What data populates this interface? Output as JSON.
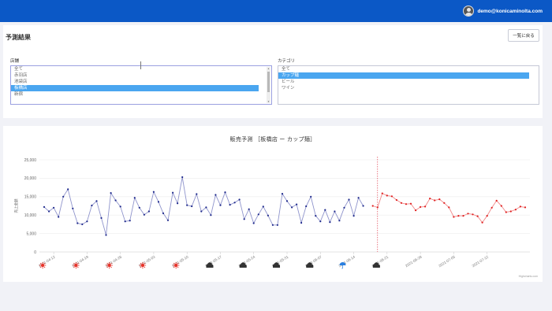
{
  "header": {
    "user_email": "demo@konicaminolta.com"
  },
  "page": {
    "title": "予測結果",
    "back_button": "一覧に戻る"
  },
  "store_select": {
    "label": "店舗",
    "options": [
      "全て",
      "赤羽店",
      "池袋店",
      "板橋店",
      "新宿"
    ],
    "selected": "板橋店"
  },
  "category_select": {
    "label": "カテゴリ",
    "options": [
      "全て",
      "カップ麺",
      "ビール",
      "ワイン"
    ],
    "selected": "カップ麺"
  },
  "chart": {
    "credit": "Highcharts.com"
  },
  "chart_data": {
    "type": "line",
    "title": "販売予測 ［板橋店 ー カップ麺］",
    "ylabel": "売上金額",
    "ylim": [
      0,
      25000
    ],
    "yticks": [
      "0",
      "5,000",
      "10,000",
      "15,000",
      "20,000",
      "25,000"
    ],
    "xticks": [
      "2021-04-12",
      "2021-04-19",
      "2021-04-26",
      "2021-05-03",
      "2021-05-10",
      "2021-05-17",
      "2021-05-24",
      "2021-05-31",
      "2021-06-07",
      "2021-06-14",
      "2021-06-21",
      "2021-06-28",
      "2021-07-05",
      "2021-07-12"
    ],
    "forecast_start": "2021-06-19",
    "weather": [
      "sunny",
      "sunny",
      "sunny",
      "sunny",
      "sunny",
      "cloudy",
      "cloudy",
      "cloudy",
      "cloudy",
      "rainy",
      "cloudy"
    ],
    "colors": {
      "actual": "#1f2a8c",
      "actual_line": "#8f94cc",
      "forecast": "#e02020",
      "forecast_line": "#f08a8a",
      "divider": "#e04050"
    },
    "series": [
      {
        "kind": "actual",
        "start": "2021-04-10",
        "values": [
          12200,
          11000,
          12000,
          9500,
          15000,
          17000,
          11800,
          7800,
          7500,
          8300,
          12600,
          13800,
          9200,
          4600,
          16000,
          14000,
          12300,
          8300,
          8500,
          14700,
          12000,
          10100,
          11000,
          16300,
          13600,
          10500,
          8600,
          16100,
          13200,
          20300,
          12700,
          12400,
          15700,
          11000,
          12100,
          10000,
          15500,
          12700,
          16200,
          12800,
          13400,
          14200,
          8900,
          11600,
          7800,
          10200,
          12300,
          9900,
          7300,
          7300,
          15800,
          13800,
          12100,
          12900,
          7900,
          12400,
          15000,
          9800,
          8300,
          11400,
          8100,
          11000,
          8500,
          12000,
          14200,
          9800,
          14700,
          12500
        ]
      },
      {
        "kind": "forecast",
        "start": "2021-06-18",
        "values": [
          12500,
          12100,
          15900,
          15300,
          15100,
          14100,
          13300,
          13000,
          13100,
          11300,
          12200,
          12300,
          14500,
          14000,
          14300,
          13300,
          12100,
          9500,
          9800,
          9800,
          10400,
          10200,
          9700,
          8000,
          9800,
          12000,
          13900,
          12500,
          10800,
          11000,
          11500,
          12300,
          12100
        ]
      }
    ]
  }
}
